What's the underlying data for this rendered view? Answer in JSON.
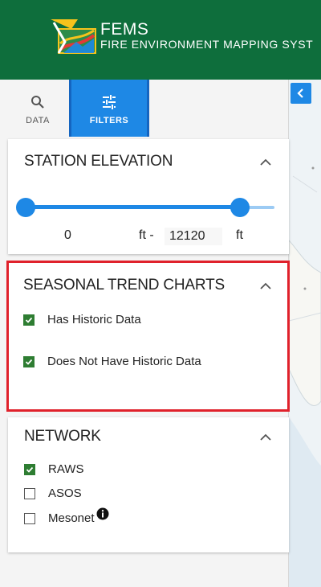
{
  "header": {
    "title": "FEMS",
    "subtitle": "FIRE ENVIRONMENT MAPPING SYST"
  },
  "tabs": [
    {
      "label": "DATA",
      "icon": "search-icon",
      "active": false
    },
    {
      "label": "FILTERS",
      "icon": "sliders-icon",
      "active": true
    }
  ],
  "elevation": {
    "title": "STATION ELEVATION",
    "min_value": "0",
    "min_unit": "ft -",
    "max_value": "12120",
    "max_unit": "ft",
    "range_fraction": [
      0.0,
      0.86
    ]
  },
  "seasonal": {
    "title": "SEASONAL TREND CHARTS",
    "options": [
      {
        "label": "Has Historic Data",
        "checked": true
      },
      {
        "label": "Does Not Have Historic Data",
        "checked": true
      }
    ]
  },
  "network": {
    "title": "NETWORK",
    "options": [
      {
        "label": "RAWS",
        "checked": true
      },
      {
        "label": "ASOS",
        "checked": false
      },
      {
        "label": "Mesonet",
        "checked": false,
        "info": true
      }
    ]
  },
  "colors": {
    "header_bg": "#0e6e3c",
    "accent": "#1e88e5",
    "checkbox_on": "#2e7d32",
    "highlight": "#e0212b"
  }
}
